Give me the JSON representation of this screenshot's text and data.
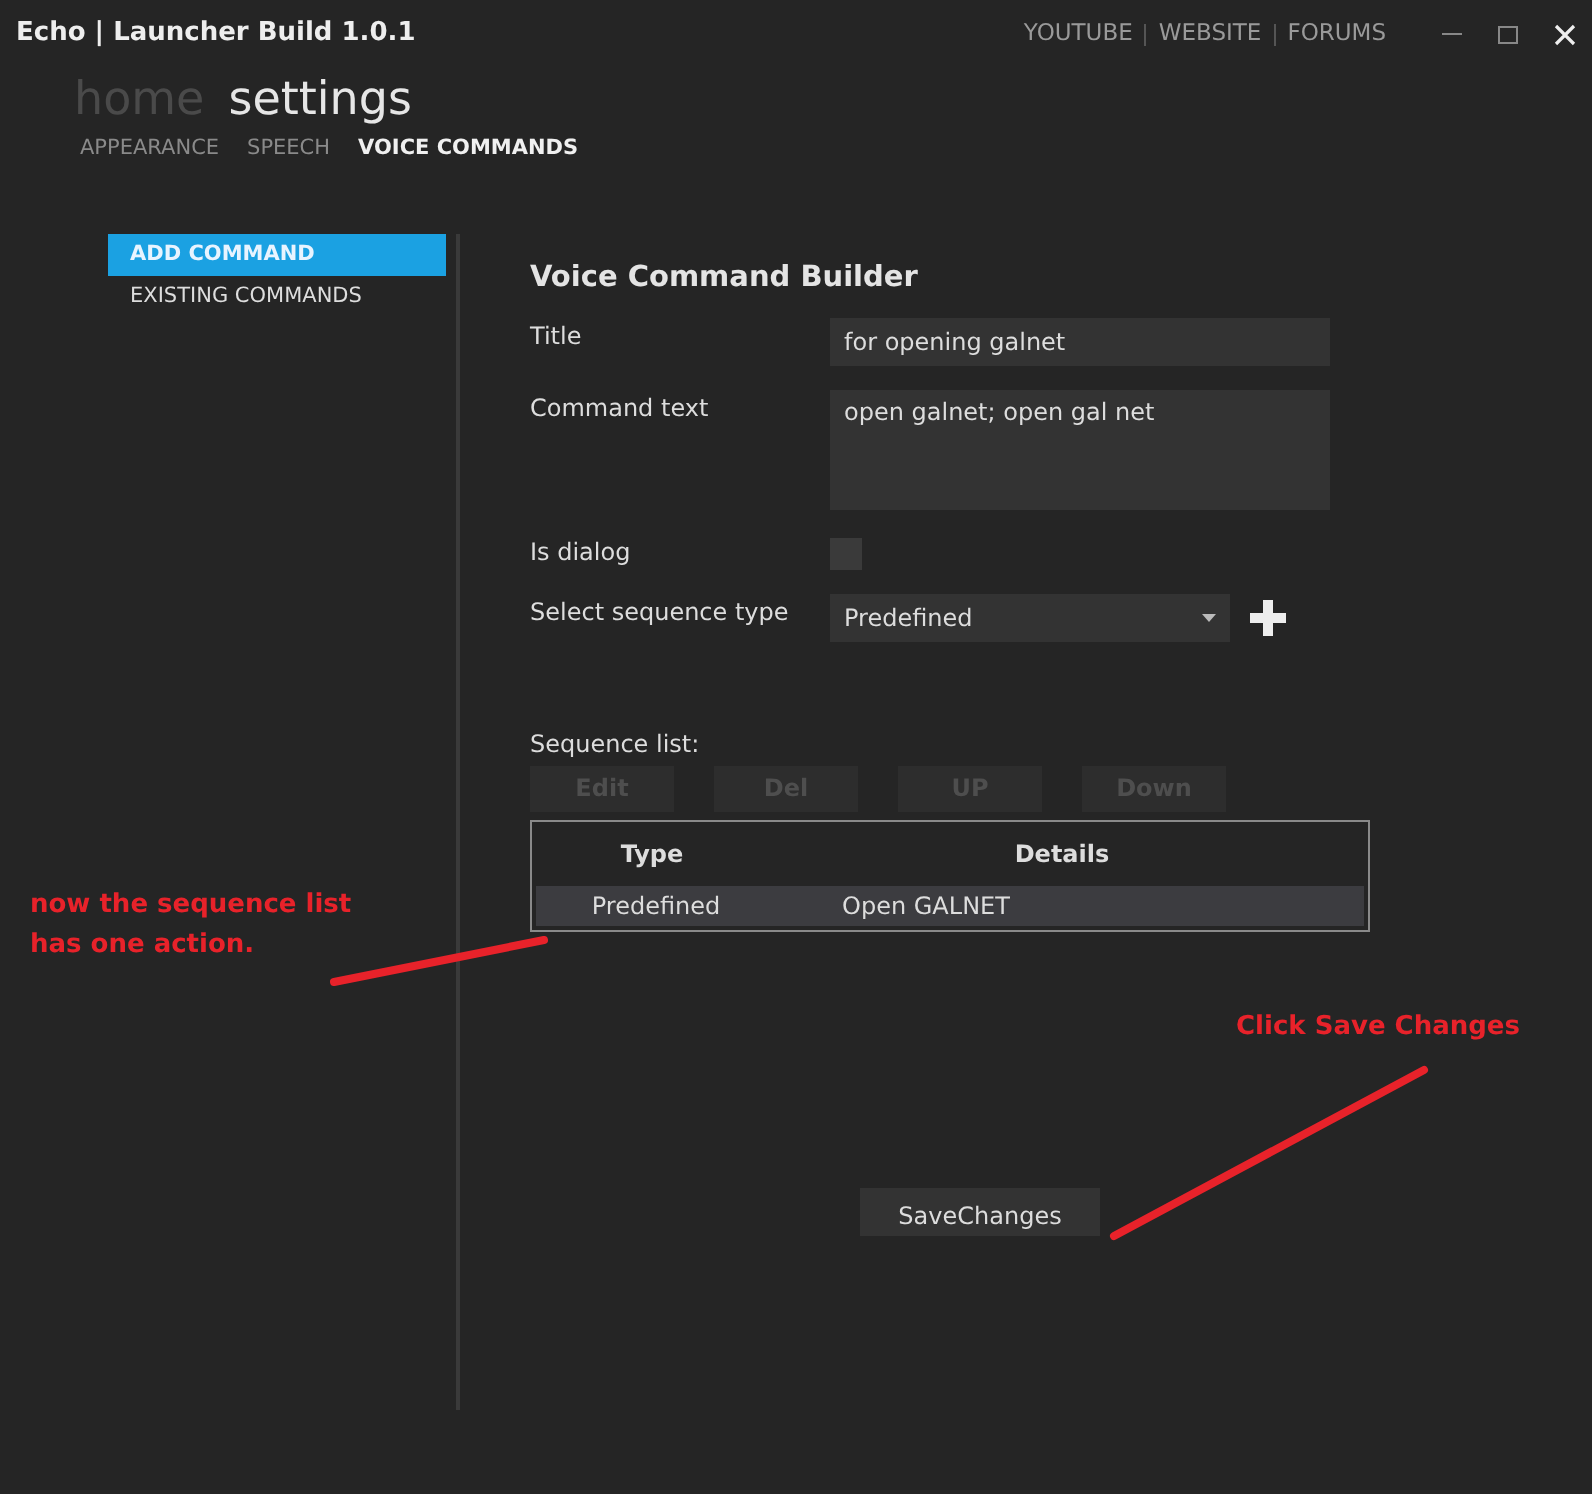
{
  "window": {
    "title": "Echo | Launcher Build 1.0.1",
    "links": [
      "YOUTUBE",
      "WEBSITE",
      "FORUMS"
    ]
  },
  "nav": [
    {
      "label": "home",
      "selected": false
    },
    {
      "label": "settings",
      "selected": true
    }
  ],
  "subnav": [
    {
      "label": "APPEARANCE",
      "selected": false
    },
    {
      "label": "SPEECH",
      "selected": false
    },
    {
      "label": "VOICE COMMANDS",
      "selected": true
    }
  ],
  "sidebar": {
    "items": [
      {
        "label": "ADD COMMAND",
        "selected": true
      },
      {
        "label": "EXISTING COMMANDS",
        "selected": false
      }
    ]
  },
  "form": {
    "heading": "Voice Command Builder",
    "fields": [
      {
        "kind": "text",
        "label": "Title",
        "value": "for opening galnet"
      },
      {
        "kind": "textarea",
        "label": "Command text",
        "value": "open galnet; open gal net"
      },
      {
        "kind": "checkbox",
        "label": "Is dialog",
        "checked": false
      },
      {
        "kind": "select",
        "label": "Select sequence type",
        "value": "Predefined"
      }
    ]
  },
  "sequence": {
    "label": "Sequence list:",
    "buttons": [
      {
        "label": "Edit",
        "disabled": true
      },
      {
        "label": "Del",
        "disabled": true
      },
      {
        "label": "UP",
        "disabled": true
      },
      {
        "label": "Down",
        "disabled": true
      }
    ],
    "table": {
      "columns": [
        "Type",
        "Details"
      ],
      "rows": [
        {
          "cells": [
            "Predefined",
            "Open GALNET"
          ],
          "selected": true
        }
      ]
    }
  },
  "save_button": "SaveChanges",
  "annotations": [
    {
      "text": "now the sequence list has one action."
    },
    {
      "text": "Click Save Changes"
    }
  ]
}
